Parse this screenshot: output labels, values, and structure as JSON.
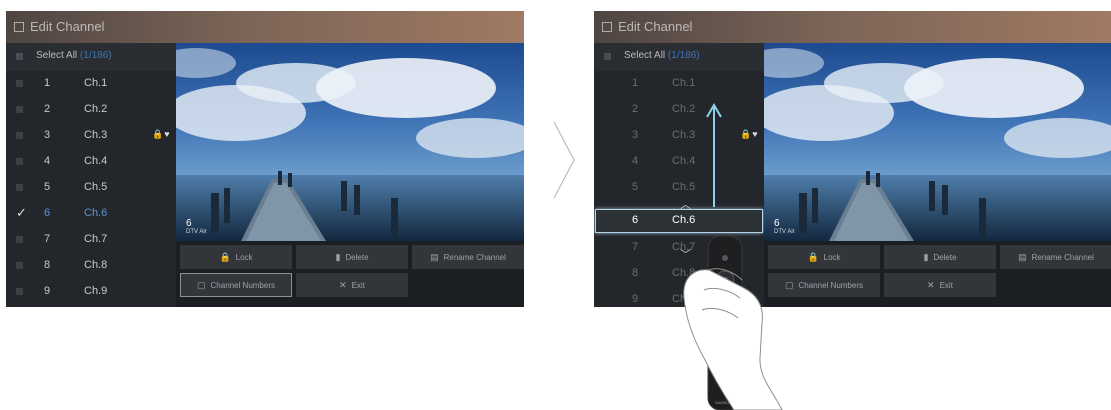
{
  "screens": [
    {
      "title": "Edit Channel",
      "select_all": "Select All",
      "select_count": "(1/186)",
      "channels": [
        {
          "num": "1",
          "name": "Ch.1"
        },
        {
          "num": "2",
          "name": "Ch.2"
        },
        {
          "num": "3",
          "name": "Ch.3",
          "icons": "🔒♥"
        },
        {
          "num": "4",
          "name": "Ch.4"
        },
        {
          "num": "5",
          "name": "Ch.5"
        },
        {
          "num": "6",
          "name": "Ch.6",
          "checked": "✓"
        },
        {
          "num": "7",
          "name": "Ch.7"
        },
        {
          "num": "8",
          "name": "Ch.8"
        },
        {
          "num": "9",
          "name": "Ch.9"
        }
      ],
      "preview_channel": "6",
      "preview_source": "DTV Air",
      "buttons": {
        "lock": "Lock",
        "delete": "Delete",
        "rename": "Rename Channel",
        "channel_numbers": "Channel Numbers",
        "exit": "Exit"
      }
    },
    {
      "title": "Edit Channel",
      "select_all": "Select All",
      "select_count": "(1/186)",
      "channels": [
        {
          "num": "1",
          "name": "Ch.1"
        },
        {
          "num": "2",
          "name": "Ch.2"
        },
        {
          "num": "3",
          "name": "Ch.3",
          "icons": "🔒♥"
        },
        {
          "num": "4",
          "name": "Ch.4"
        },
        {
          "num": "5",
          "name": "Ch.5"
        },
        {
          "num": "6",
          "name": "Ch.6"
        },
        {
          "num": "7",
          "name": "Ch.7"
        },
        {
          "num": "8",
          "name": "Ch.8"
        },
        {
          "num": "9",
          "name": "Ch.9"
        }
      ],
      "preview_channel": "6",
      "preview_source": "DTV Air",
      "buttons": {
        "lock": "Lock",
        "delete": "Delete",
        "rename": "Rename Channel",
        "channel_numbers": "Channel Numbers",
        "exit": "Exit"
      }
    }
  ],
  "icons": {
    "lock": "lock-icon",
    "delete": "trash-icon",
    "rename": "rename-icon",
    "channel_numbers": "number-icon",
    "exit": "close-icon",
    "next": "chevron-right-icon",
    "up_arrow": "arrow-up-icon"
  },
  "remote_brand": "SAMSUNG",
  "colors": {
    "accent_blue": "#5a94d6",
    "focus_border": "#b9d3e6",
    "title_bar": "#7b6457"
  }
}
